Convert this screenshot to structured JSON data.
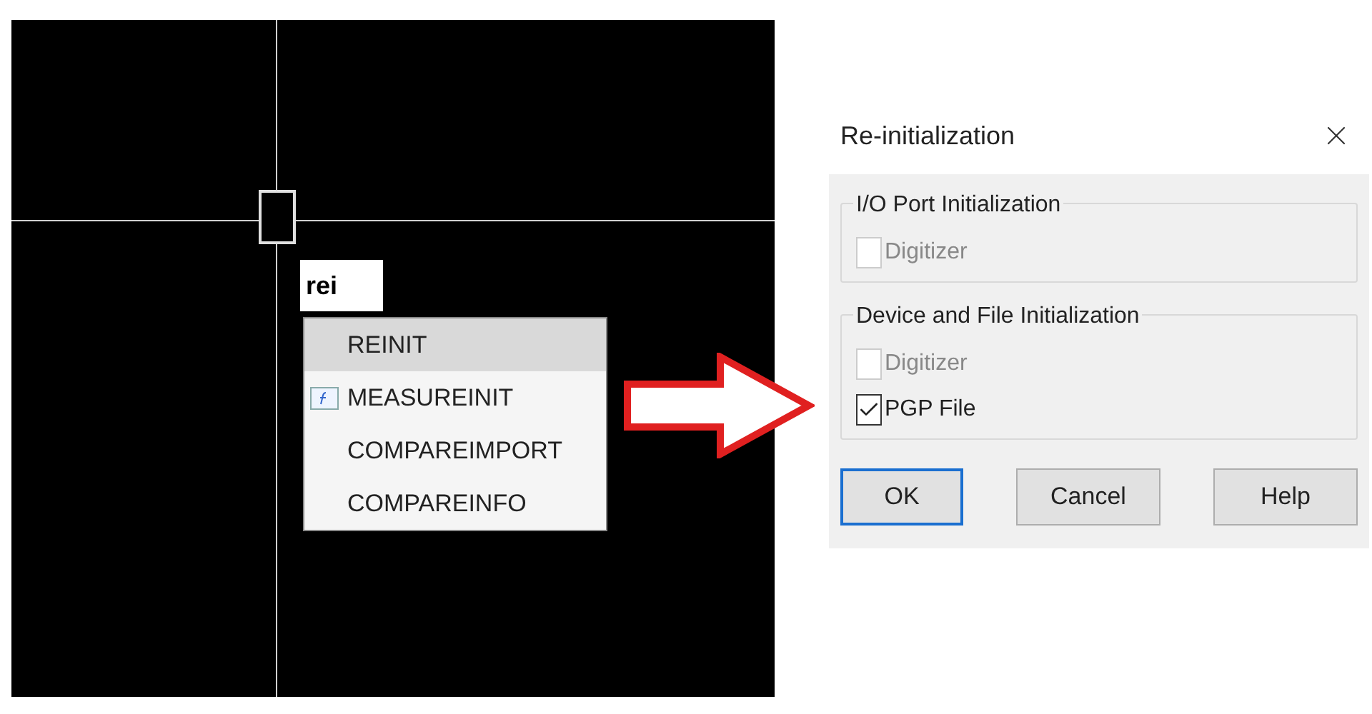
{
  "canvas": {
    "command_input": {
      "value": "rei"
    },
    "suggestions": [
      {
        "label": "REINIT",
        "selected": true,
        "kind": "plain"
      },
      {
        "label": "MEASUREINIT",
        "selected": false,
        "kind": "with_icon"
      },
      {
        "label": "COMPAREIMPORT",
        "selected": false,
        "kind": "plain"
      },
      {
        "label": "COMPAREINFO",
        "selected": false,
        "kind": "plain"
      }
    ]
  },
  "dialog": {
    "title": "Re-initialization",
    "groups": [
      {
        "label": "I/O Port Initialization",
        "checkboxes": [
          {
            "label": "Digitizer",
            "checked": false,
            "disabled": true
          }
        ]
      },
      {
        "label": "Device and File Initialization",
        "checkboxes": [
          {
            "label": "Digitizer",
            "checked": false,
            "disabled": true
          },
          {
            "label": "PGP File",
            "checked": true,
            "disabled": false
          }
        ]
      }
    ],
    "buttons": [
      {
        "label": "OK",
        "focused": true
      },
      {
        "label": "Cancel",
        "focused": false
      },
      {
        "label": "Help",
        "focused": false
      }
    ]
  }
}
